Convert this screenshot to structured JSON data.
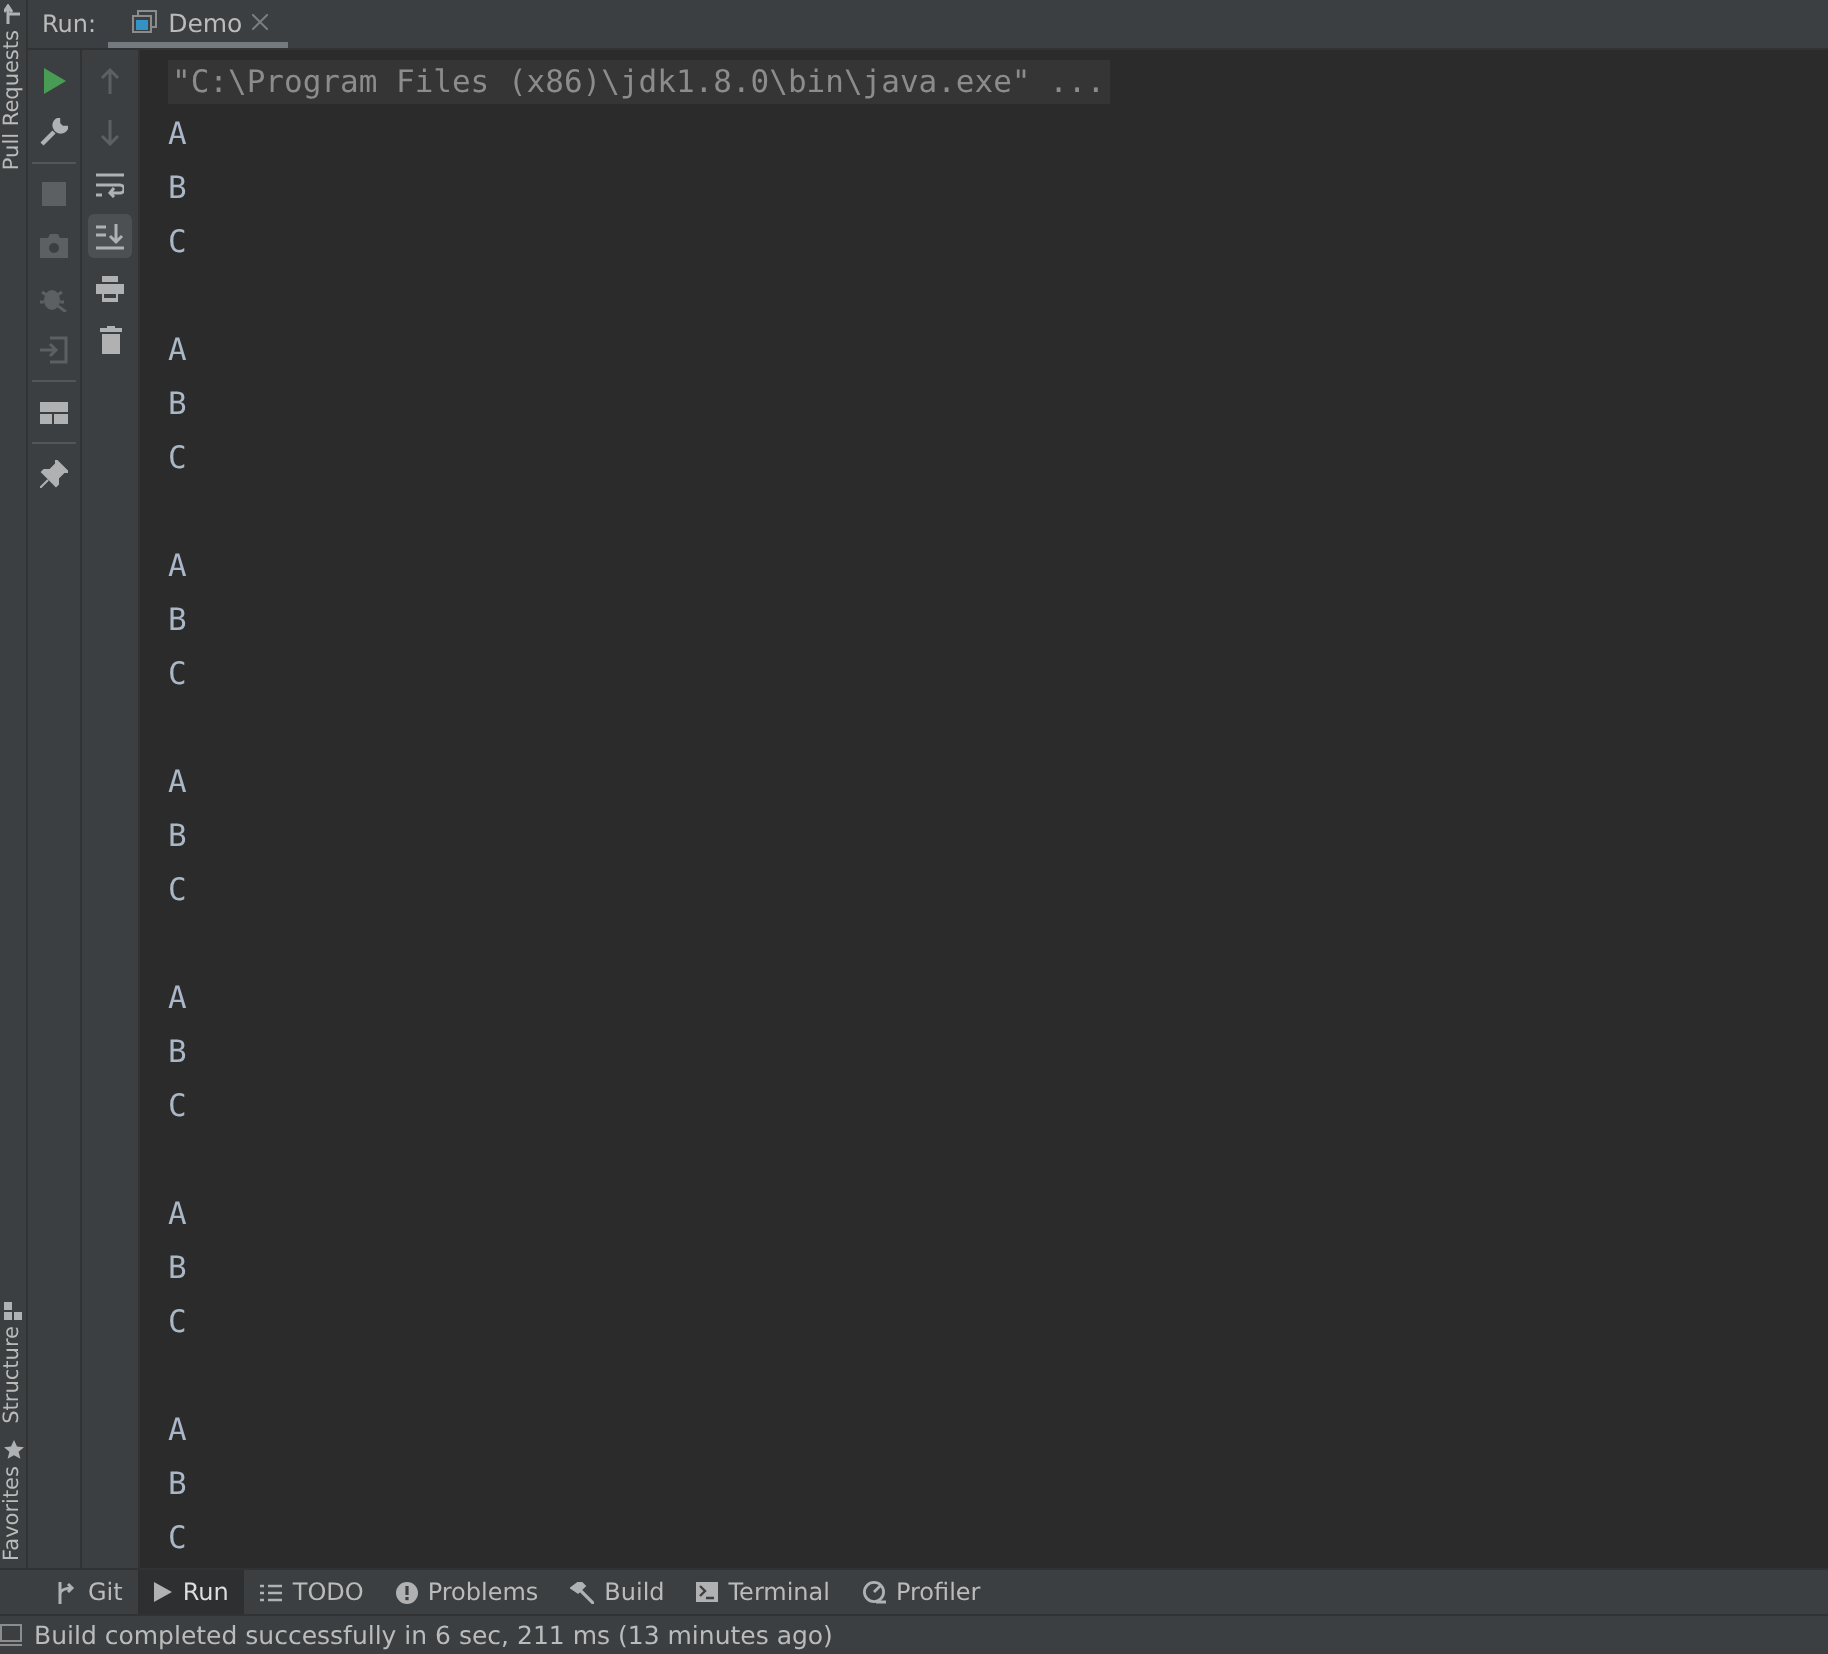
{
  "side_stripe": {
    "top": [
      {
        "label": "Pull Requests",
        "kind": "pr"
      }
    ],
    "bottom": [
      {
        "label": "Structure",
        "kind": "structure"
      },
      {
        "label": "Favorites",
        "kind": "star"
      }
    ]
  },
  "run_header": {
    "label": "Run:",
    "tabs": [
      {
        "label": "Demo",
        "selected": true
      }
    ]
  },
  "toolbar_main": [
    {
      "kind": "run",
      "disabled": false
    },
    {
      "kind": "wrench",
      "disabled": false
    },
    {
      "kind": "divider"
    },
    {
      "kind": "stop",
      "disabled": true
    },
    {
      "kind": "camera",
      "disabled": true
    },
    {
      "kind": "bug",
      "disabled": true
    },
    {
      "kind": "exit",
      "disabled": true
    },
    {
      "kind": "divider"
    },
    {
      "kind": "layout",
      "disabled": false
    },
    {
      "kind": "divider"
    },
    {
      "kind": "pin",
      "disabled": false
    }
  ],
  "toolbar_output": [
    {
      "kind": "up",
      "disabled": true,
      "on": false
    },
    {
      "kind": "down",
      "disabled": true,
      "on": false
    },
    {
      "kind": "wrap",
      "disabled": false,
      "on": false
    },
    {
      "kind": "scroll",
      "disabled": false,
      "on": true
    },
    {
      "kind": "print",
      "disabled": false,
      "on": false
    },
    {
      "kind": "trash",
      "disabled": false,
      "on": false
    }
  ],
  "console": {
    "command": "\"C:\\Program Files (x86)\\jdk1.8.0\\bin\\java.exe\" ...",
    "blocks": [
      [
        "A",
        "B",
        "C"
      ],
      [
        "A",
        "B",
        "C"
      ],
      [
        "A",
        "B",
        "C"
      ],
      [
        "A",
        "B",
        "C"
      ],
      [
        "A",
        "B",
        "C"
      ],
      [
        "A",
        "B",
        "C"
      ],
      [
        "A",
        "B",
        "C"
      ]
    ]
  },
  "tool_tabs": [
    {
      "label": "Git",
      "kind": "git",
      "selected": false
    },
    {
      "label": "Run",
      "kind": "run",
      "selected": true
    },
    {
      "label": "TODO",
      "kind": "todo",
      "selected": false
    },
    {
      "label": "Problems",
      "kind": "problems",
      "selected": false
    },
    {
      "label": "Build",
      "kind": "build",
      "selected": false
    },
    {
      "label": "Terminal",
      "kind": "terminal",
      "selected": false
    },
    {
      "label": "Profiler",
      "kind": "profiler",
      "selected": false
    }
  ],
  "status_bar": {
    "message": "Build completed successfully in 6 sec, 211 ms (13 minutes ago)"
  }
}
